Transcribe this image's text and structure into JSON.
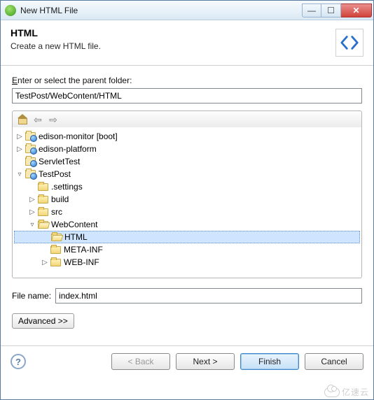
{
  "window": {
    "title": "New HTML File"
  },
  "banner": {
    "heading": "HTML",
    "sub": "Create a new HTML file."
  },
  "labels": {
    "parent_prefix": "E",
    "parent_rest": "nter or select the parent folder:",
    "filename_prefix": "File na",
    "filename_ul": "m",
    "filename_rest": "e:"
  },
  "fields": {
    "parent_folder": "TestPost/WebContent/HTML",
    "file_name": "index.html"
  },
  "tree": {
    "items": [
      {
        "indent": 0,
        "twisty": "▷",
        "icon": "proj",
        "label": "edison-monitor [boot]"
      },
      {
        "indent": 0,
        "twisty": "▷",
        "icon": "proj",
        "label": "edison-platform"
      },
      {
        "indent": 0,
        "twisty": "",
        "icon": "proj",
        "label": "ServletTest"
      },
      {
        "indent": 0,
        "twisty": "▿",
        "icon": "proj",
        "label": "TestPost"
      },
      {
        "indent": 1,
        "twisty": "",
        "icon": "folder",
        "label": ".settings"
      },
      {
        "indent": 1,
        "twisty": "▷",
        "icon": "folder",
        "label": "build"
      },
      {
        "indent": 1,
        "twisty": "▷",
        "icon": "folder",
        "label": "src"
      },
      {
        "indent": 1,
        "twisty": "▿",
        "icon": "folder-open",
        "label": "WebContent"
      },
      {
        "indent": 2,
        "twisty": "",
        "icon": "folder-open",
        "label": "HTML",
        "selected": true
      },
      {
        "indent": 2,
        "twisty": "",
        "icon": "folder",
        "label": "META-INF"
      },
      {
        "indent": 2,
        "twisty": "▷",
        "icon": "folder",
        "label": "WEB-INF"
      }
    ]
  },
  "buttons": {
    "advanced": "Advanced >>",
    "back": "< Back",
    "next": "Next >",
    "finish": "Finish",
    "cancel": "Cancel"
  },
  "watermark": "亿速云"
}
